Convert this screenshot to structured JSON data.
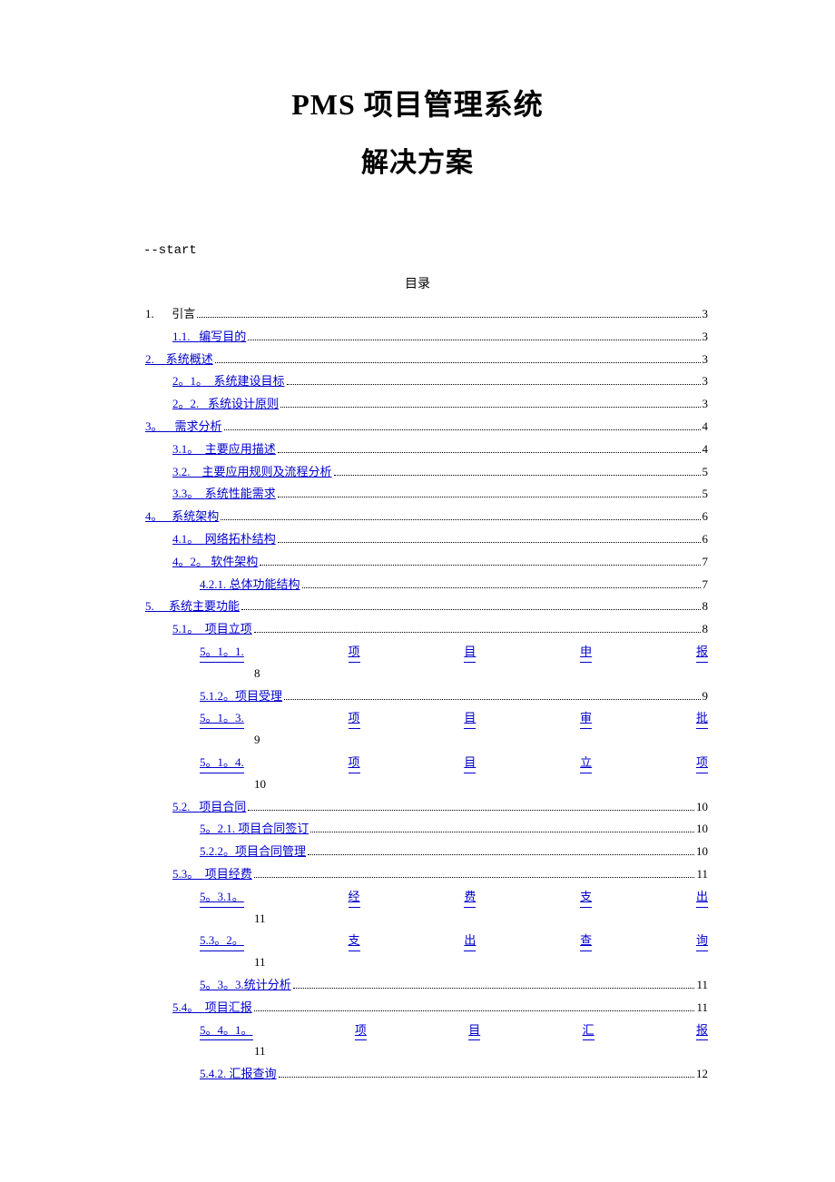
{
  "title_main": "PMS 项目管理系统",
  "title_sub": "解决方案",
  "marker": "--start",
  "toc_heading": "目录",
  "toc": [
    {
      "indent": 0,
      "num": "1.",
      "sep": "      ",
      "text": "引言",
      "page": "3",
      "link": false
    },
    {
      "indent": 1,
      "num": "1.1.",
      "sep": "   ",
      "text": "编写目的",
      "page": "3",
      "link": true
    },
    {
      "indent": 0,
      "num": "2.",
      "sep": "    ",
      "text": "系统概述",
      "page": "3",
      "link": true
    },
    {
      "indent": 1,
      "num": "2。1。",
      "sep": "  ",
      "text": "系统建设目标",
      "page": "3",
      "link": true
    },
    {
      "indent": 1,
      "num": "2。2.",
      "sep": "   ",
      "text": "系统设计原则",
      "page": "3",
      "link": true
    },
    {
      "indent": 0,
      "num": "3。",
      "sep": "    ",
      "text": "需求分析",
      "page": "4",
      "link": true
    },
    {
      "indent": 1,
      "num": "3.1。",
      "sep": "  ",
      "text": "主要应用描述",
      "page": "4",
      "link": true
    },
    {
      "indent": 1,
      "num": "3.2.",
      "sep": "    ",
      "text": "主要应用规则及流程分析",
      "page": "5",
      "link": true
    },
    {
      "indent": 1,
      "num": "3.3。",
      "sep": "  ",
      "text": "系统性能需求",
      "page": "5",
      "link": true
    },
    {
      "indent": 0,
      "num": "4。",
      "sep": "   ",
      "text": "系统架构",
      "page": "6",
      "link": true
    },
    {
      "indent": 1,
      "num": "4.1。",
      "sep": "  ",
      "text": "网络拓朴结构",
      "page": "6",
      "link": true
    },
    {
      "indent": 1,
      "num": "4。2。",
      "sep": " ",
      "text": "软件架构",
      "page": "7",
      "link": true
    },
    {
      "indent": 2,
      "num": "4.2.1.",
      "sep": " ",
      "text": "总体功能结构",
      "page": "7",
      "link": true
    },
    {
      "indent": 0,
      "num": "5.",
      "sep": "     ",
      "text": "系统主要功能",
      "page": "8",
      "link": true
    },
    {
      "indent": 1,
      "num": "5.1。",
      "sep": "  ",
      "text": "项目立项",
      "page": "8",
      "link": true
    },
    {
      "indent": 2,
      "wide": true,
      "num": "5。1。1.",
      "text": "项目申报",
      "chars": [
        "项",
        "目",
        "申",
        "报"
      ],
      "page": "8",
      "link": true
    },
    {
      "indent": 2,
      "num": "5.1.2。",
      "sep": "",
      "text": "项目受理",
      "page": "9",
      "link": true
    },
    {
      "indent": 2,
      "wide": true,
      "num": "5。1。3.",
      "text": "项目审批",
      "chars": [
        "项",
        "目",
        "审",
        "批"
      ],
      "page": "9",
      "link": true
    },
    {
      "indent": 2,
      "wide": true,
      "num": "5。1。4.",
      "text": "项目立项",
      "chars": [
        "项",
        "目",
        "立",
        "项"
      ],
      "page": "10",
      "link": true
    },
    {
      "indent": 1,
      "num": "5.2.",
      "sep": "   ",
      "text": "项目合同",
      "page": "10",
      "link": true
    },
    {
      "indent": 2,
      "num": "5。2.1.",
      "sep": " ",
      "text": "项目合同签订",
      "page": "10",
      "link": true
    },
    {
      "indent": 2,
      "num": "5.2.2。",
      "sep": "",
      "text": "项目合同管理",
      "page": "10",
      "link": true
    },
    {
      "indent": 1,
      "num": "5.3。",
      "sep": "  ",
      "text": "项目经费",
      "page": "11",
      "link": true
    },
    {
      "indent": 2,
      "wide": true,
      "num": "5。3.1。",
      "text": "经费支出",
      "chars": [
        "经",
        "费",
        "支",
        "出"
      ],
      "page": "11",
      "link": true
    },
    {
      "indent": 2,
      "wide": true,
      "num": "5.3。2。",
      "text": "支出查询",
      "chars": [
        "支",
        "出",
        "查",
        "询"
      ],
      "page": "11",
      "link": true
    },
    {
      "indent": 2,
      "num": "5。3。3.",
      "sep": "",
      "text": "统计分析",
      "page": "11",
      "link": true
    },
    {
      "indent": 1,
      "num": "5.4。",
      "sep": "  ",
      "text": "项目汇报",
      "page": "11",
      "link": true
    },
    {
      "indent": 2,
      "wide": true,
      "num": "5。4。1。",
      "text": "项目汇报",
      "chars": [
        "项",
        "目",
        "汇",
        "报"
      ],
      "page": "11",
      "link": true
    },
    {
      "indent": 2,
      "num": "5.4.2.",
      "sep": " ",
      "text": "汇报查询",
      "page": "12",
      "link": true
    }
  ]
}
